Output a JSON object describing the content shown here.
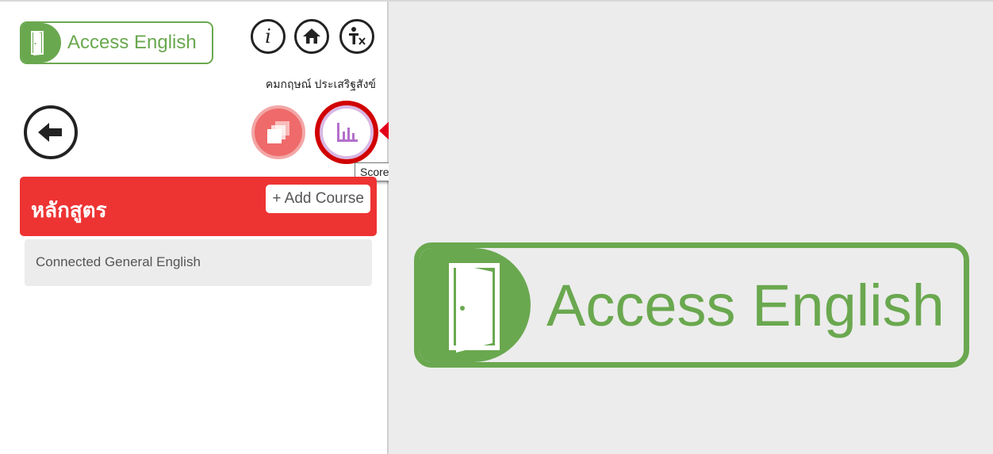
{
  "app": {
    "logo_text": "Access English",
    "colors": {
      "brand_green": "#6aa84f",
      "header_red": "#ee3333",
      "courses_pink": "#ef6a6a",
      "scores_purple": "#b46fcb",
      "annotation_red": "#d10000"
    }
  },
  "toolbar": {
    "info_icon": "i",
    "home_icon": "home-icon",
    "accessibility_icon": "accessibility-icon"
  },
  "user": {
    "name": "คมกฤษณ์ ประเสริฐสังข์"
  },
  "nav": {
    "back_icon": "arrow-left-icon",
    "courses_icon": "stacked-cards-icon",
    "scores_icon": "bar-chart-icon",
    "scores_tooltip": "Scores"
  },
  "courses": {
    "title": "หลักสูตร",
    "add_label": "+ Add Course",
    "items": [
      {
        "label": "Connected General English"
      }
    ]
  },
  "main": {
    "logo_text": "Access English"
  }
}
